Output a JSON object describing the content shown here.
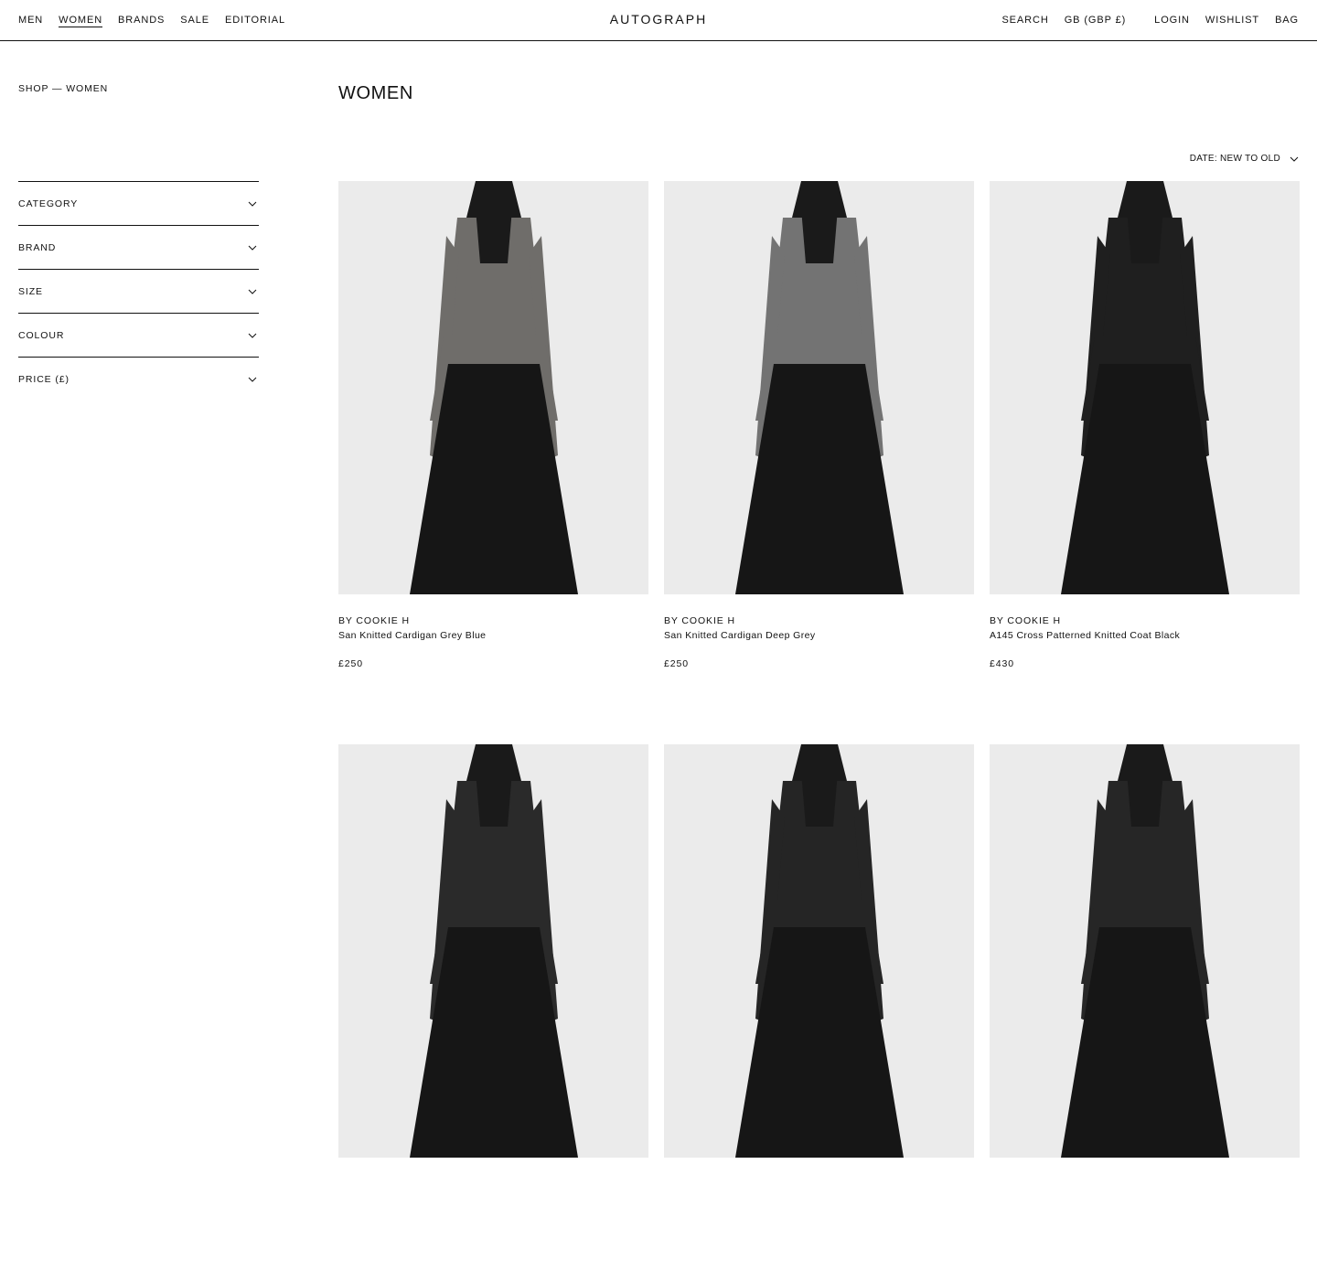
{
  "header": {
    "nav_left": [
      "MEN",
      "WOMEN",
      "BRANDS",
      "SALE",
      "EDITORIAL"
    ],
    "active_nav": "WOMEN",
    "logo": "AUTOGRAPH",
    "search": "SEARCH",
    "currency": "GB (GBP £)",
    "login": "LOGIN",
    "wishlist": "WISHLIST",
    "bag": "BAG"
  },
  "breadcrumb": "SHOP — WOMEN",
  "filters": [
    "CATEGORY",
    "BRAND",
    "SIZE",
    "COLOUR",
    "PRICE (£)"
  ],
  "page_title": "WOMEN",
  "sort": {
    "label": "DATE: NEW TO OLD"
  },
  "products": [
    {
      "brand": "BY COOKIE H",
      "name": "San Knitted Cardigan Grey Blue",
      "price": "£250",
      "top_color": "#6f6d6a"
    },
    {
      "brand": "BY COOKIE H",
      "name": "San Knitted Cardigan Deep Grey",
      "price": "£250",
      "top_color": "#737373"
    },
    {
      "brand": "BY COOKIE H",
      "name": "A145 Cross Patterned Knitted Coat Black",
      "price": "£430",
      "top_color": "#1f1f1f"
    },
    {
      "brand": "",
      "name": "",
      "price": "",
      "top_color": "#2a2a2a"
    },
    {
      "brand": "",
      "name": "",
      "price": "",
      "top_color": "#252525"
    },
    {
      "brand": "",
      "name": "",
      "price": "",
      "top_color": "#262626"
    }
  ],
  "colors": {
    "text": "#111111",
    "background": "#ffffff",
    "image_bg": "#ebebeb",
    "skirt": "#161616",
    "hair": "#1a1a1a"
  }
}
